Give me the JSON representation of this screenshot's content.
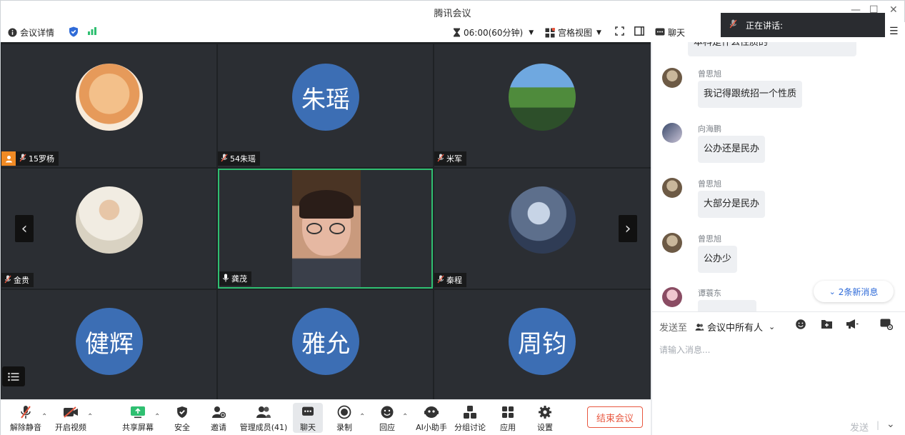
{
  "window": {
    "title": "腾讯会议"
  },
  "topbar": {
    "meeting_info": "会议详情",
    "timer": "06:00(60分钟)",
    "view_mode": "宫格视图",
    "chat": "聊天"
  },
  "speaking": {
    "label": "正在讲话:"
  },
  "participants": [
    {
      "name": "15罗杨",
      "avatar": "photo-plush",
      "host": true
    },
    {
      "name": "54朱瑶",
      "avatar_text": "朱瑶"
    },
    {
      "name": "米军",
      "avatar": "photo-landscape"
    },
    {
      "name": "金贵",
      "avatar": "photo-person"
    },
    {
      "name": "龚茂",
      "avatar": "video",
      "active": true,
      "mic_on": true
    },
    {
      "name": "秦程",
      "avatar": "photo-anime"
    },
    {
      "name": "",
      "avatar_text": "健辉"
    },
    {
      "name": "",
      "avatar_text": "雅允"
    },
    {
      "name": "",
      "avatar_text": "周钧"
    }
  ],
  "toolbar": {
    "unmute": "解除静音",
    "start_video": "开启视频",
    "share_screen": "共享屏幕",
    "security": "安全",
    "invite": "邀请",
    "manage_members": "管理成员(41)",
    "chat": "聊天",
    "record": "录制",
    "reactions": "回应",
    "ai_assistant": "AI小助手",
    "breakout": "分组讨论",
    "apps": "应用",
    "settings": "设置",
    "end_meeting": "结束会议"
  },
  "chat": {
    "partial_message": "本科是什么性质的",
    "messages": [
      {
        "sender": "曾思旭",
        "text": "我记得跟统招一个性质"
      },
      {
        "sender": "向海鹏",
        "text": "公办还是民办"
      },
      {
        "sender": "曾思旭",
        "text": "大部分是民办"
      },
      {
        "sender": "曾思旭",
        "text": "公办少"
      },
      {
        "sender": "谭蓑东",
        "text": ""
      }
    ],
    "new_messages": "2条新消息",
    "send_to_label": "发送至",
    "send_to_target": "会议中所有人",
    "input_placeholder": "请输入消息...",
    "send_button": "发送"
  },
  "colors": {
    "accent": "#2f6bd8",
    "end": "#e8573f",
    "avatar_blue": "#3c6eb4",
    "active_border": "#2fbf71"
  }
}
